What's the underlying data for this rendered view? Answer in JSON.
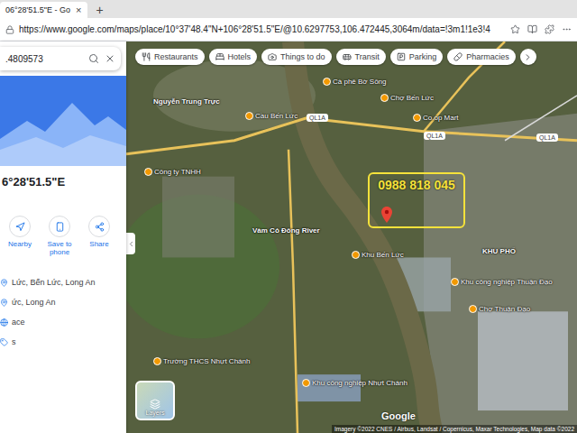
{
  "browser": {
    "tab": {
      "title": "06°28'51.5\"E - Go",
      "close": "×",
      "selected": true
    },
    "new_tab": "+",
    "url": "https://www.google.com/maps/place/10°37'48.4\"N+106°28'51.5\"E/@10.6297753,106.472445,3064m/data=!3m1!1e3!4"
  },
  "side_panel": {
    "search": {
      "value": ".4809573"
    },
    "heading": "6°28'51.5\"E",
    "actions": [
      {
        "label": "Nearby"
      },
      {
        "label": "Save to phone"
      },
      {
        "label": "Share"
      }
    ],
    "details": [
      "Lức, Bến Lức, Long An",
      "ức, Long An",
      "ace",
      "s"
    ]
  },
  "map": {
    "chips": [
      {
        "label": "Restaurants"
      },
      {
        "label": "Hotels"
      },
      {
        "label": "Things to do"
      },
      {
        "label": "Transit"
      },
      {
        "label": "Parking"
      },
      {
        "label": "Pharmacies"
      }
    ],
    "labels": [
      {
        "text": "Cà phê Bờ Sông",
        "kind": "place"
      },
      {
        "text": "Chợ Bến Lức",
        "kind": "place"
      },
      {
        "text": "Co.op Mart",
        "kind": "place"
      },
      {
        "text": "Cầu Bến Lức",
        "kind": "place"
      },
      {
        "text": "QL1A",
        "kind": "road"
      },
      {
        "text": "QL1A",
        "kind": "road"
      },
      {
        "text": "QL1A",
        "kind": "road"
      },
      {
        "text": "Nguyễn Trung Trực",
        "kind": "area"
      },
      {
        "text": "Công ty TNHH",
        "kind": "place"
      },
      {
        "text": "Vàm Cỏ Đông River",
        "kind": "area"
      },
      {
        "text": "KHU PHỐ",
        "kind": "area"
      },
      {
        "text": "Khu Bến Lức",
        "kind": "place"
      },
      {
        "text": "Chợ Thuận Đạo",
        "kind": "place"
      },
      {
        "text": "Khu công nghiệp Thuận Đạo",
        "kind": "place"
      },
      {
        "text": "Trường THCS Nhựt Chánh",
        "kind": "place"
      },
      {
        "text": "Khu công nghiệp Nhựt Chánh",
        "kind": "place"
      }
    ],
    "phone_box": {
      "text": "0988 818 045"
    },
    "layers_button": "Layers",
    "logo": "Google",
    "attribution": "Imagery ©2022 CNES / Airbus, Landsat / Copernicus, Maxar Technologies, Map data ©2022"
  }
}
